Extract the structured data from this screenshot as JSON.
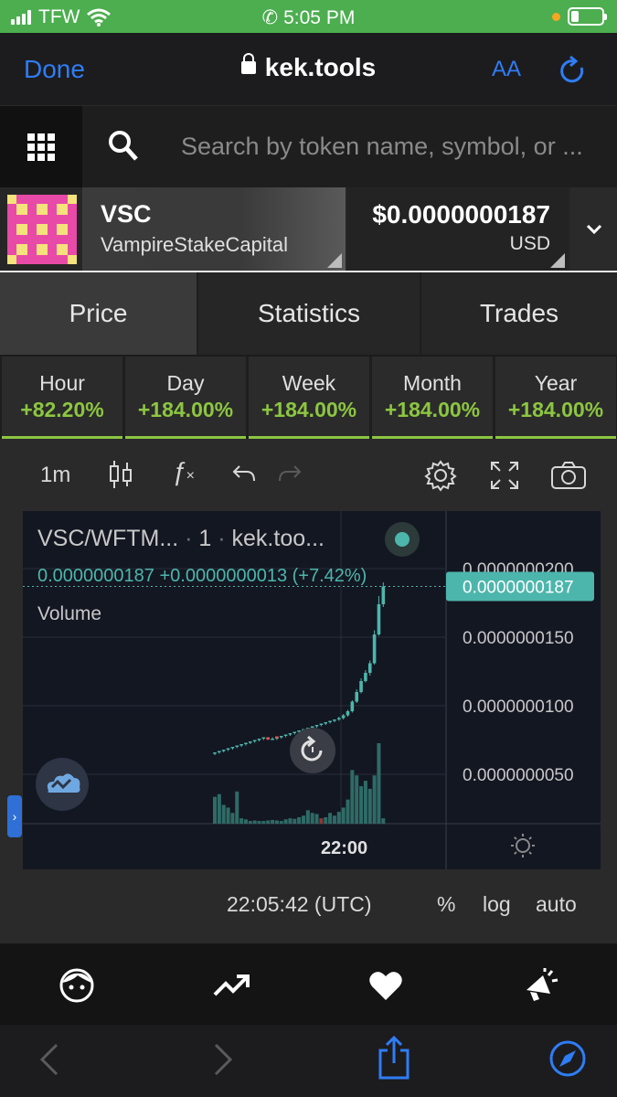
{
  "status_bar": {
    "carrier": "TFW",
    "time": "5:05 PM"
  },
  "browser": {
    "done_label": "Done",
    "url": "kek.tools",
    "text_size_label": "AA"
  },
  "search": {
    "placeholder": "Search by token name, symbol, or ..."
  },
  "token": {
    "symbol": "VSC",
    "name": "VampireStakeCapital",
    "price": "$0.0000000187",
    "currency": "USD"
  },
  "tabs": [
    {
      "label": "Price",
      "active": true
    },
    {
      "label": "Statistics",
      "active": false
    },
    {
      "label": "Trades",
      "active": false
    }
  ],
  "periods": [
    {
      "label": "Hour",
      "change": "+82.20%"
    },
    {
      "label": "Day",
      "change": "+184.00%"
    },
    {
      "label": "Week",
      "change": "+184.00%"
    },
    {
      "label": "Month",
      "change": "+184.00%"
    },
    {
      "label": "Year",
      "change": "+184.00%"
    }
  ],
  "chart_toolbar": {
    "interval": "1m"
  },
  "chart": {
    "pair": "VSC/WFTM...",
    "interval_label": "1",
    "source": "kek.too...",
    "last_price": "0.0000000187",
    "change": "+0.0000000013 (+7.42%)",
    "volume_label": "Volume",
    "price_axis_labels": [
      "0.0000000200",
      "0.0000000150",
      "0.0000000100",
      "0.0000000050"
    ],
    "time_label": "22:00",
    "clock": "22:05:42 (UTC)",
    "scale_percent": "%",
    "scale_log": "log",
    "scale_auto": "auto",
    "colors": {
      "up": "#4db6ac",
      "down": "#ef5350",
      "accent": "#8cc641",
      "link": "#2f7df6"
    }
  },
  "chart_data": {
    "type": "candlestick",
    "title": "",
    "ylim": [
      0.0,
      2.05e-08
    ],
    "y_ticks": [
      5e-09,
      1e-08,
      1.5e-08,
      2e-08
    ],
    "x_tick_labels": [
      "22:00"
    ],
    "candles": [
      {
        "o": 6.5e-09,
        "h": 6.6e-09,
        "l": 6.4e-09,
        "c": 6.6e-09
      },
      {
        "o": 6.6e-09,
        "h": 6.7e-09,
        "l": 6.5e-09,
        "c": 6.7e-09
      },
      {
        "o": 6.7e-09,
        "h": 6.8e-09,
        "l": 6.6e-09,
        "c": 6.8e-09
      },
      {
        "o": 6.8e-09,
        "h": 6.9e-09,
        "l": 6.7e-09,
        "c": 6.9e-09
      },
      {
        "o": 6.9e-09,
        "h": 7e-09,
        "l": 6.8e-09,
        "c": 7e-09
      },
      {
        "o": 7e-09,
        "h": 7.1e-09,
        "l": 6.9e-09,
        "c": 7.1e-09
      },
      {
        "o": 7.1e-09,
        "h": 7.2e-09,
        "l": 7e-09,
        "c": 7.2e-09
      },
      {
        "o": 7.2e-09,
        "h": 7.3e-09,
        "l": 7.1e-09,
        "c": 7.3e-09
      },
      {
        "o": 7.3e-09,
        "h": 7.4e-09,
        "l": 7.2e-09,
        "c": 7.4e-09
      },
      {
        "o": 7.4e-09,
        "h": 7.5e-09,
        "l": 7.3e-09,
        "c": 7.5e-09
      },
      {
        "o": 7.5e-09,
        "h": 7.6e-09,
        "l": 7.4e-09,
        "c": 7.6e-09
      },
      {
        "o": 7.6e-09,
        "h": 7.7e-09,
        "l": 7.5e-09,
        "c": 7.7e-09
      },
      {
        "o": 7.7e-09,
        "h": 7.7e-09,
        "l": 7.5e-09,
        "c": 7.6e-09
      },
      {
        "o": 7.6e-09,
        "h": 7.7e-09,
        "l": 7.5e-09,
        "c": 7.6e-09
      },
      {
        "o": 7.6e-09,
        "h": 7.7e-09,
        "l": 7.5e-09,
        "c": 7.7e-09
      },
      {
        "o": 7.7e-09,
        "h": 7.8e-09,
        "l": 7.6e-09,
        "c": 7.8e-09
      },
      {
        "o": 7.8e-09,
        "h": 7.9e-09,
        "l": 7.7e-09,
        "c": 7.9e-09
      },
      {
        "o": 7.9e-09,
        "h": 8e-09,
        "l": 7.8e-09,
        "c": 8e-09
      },
      {
        "o": 8e-09,
        "h": 8.1e-09,
        "l": 7.9e-09,
        "c": 8.1e-09
      },
      {
        "o": 8.1e-09,
        "h": 8.2e-09,
        "l": 8e-09,
        "c": 8.2e-09
      },
      {
        "o": 8.2e-09,
        "h": 8.3e-09,
        "l": 8.1e-09,
        "c": 8.3e-09
      },
      {
        "o": 8.3e-09,
        "h": 8.4e-09,
        "l": 8.2e-09,
        "c": 8.4e-09
      },
      {
        "o": 8.4e-09,
        "h": 8.5e-09,
        "l": 8.3e-09,
        "c": 8.5e-09
      },
      {
        "o": 8.5e-09,
        "h": 8.6e-09,
        "l": 8.4e-09,
        "c": 8.6e-09
      },
      {
        "o": 8.6e-09,
        "h": 8.7e-09,
        "l": 8.5e-09,
        "c": 8.7e-09
      },
      {
        "o": 8.7e-09,
        "h": 8.8e-09,
        "l": 8.6e-09,
        "c": 8.8e-09
      },
      {
        "o": 8.8e-09,
        "h": 8.9e-09,
        "l": 8.7e-09,
        "c": 8.9e-09
      },
      {
        "o": 8.9e-09,
        "h": 9e-09,
        "l": 8.8e-09,
        "c": 9e-09
      },
      {
        "o": 9e-09,
        "h": 9.2e-09,
        "l": 8.9e-09,
        "c": 9.1e-09
      },
      {
        "o": 9.1e-09,
        "h": 9.4e-09,
        "l": 9e-09,
        "c": 9.3e-09
      },
      {
        "o": 9.3e-09,
        "h": 9.7e-09,
        "l": 9.2e-09,
        "c": 9.6e-09
      },
      {
        "o": 9.6e-09,
        "h": 1.04e-08,
        "l": 9.5e-09,
        "c": 1.03e-08
      },
      {
        "o": 1.03e-08,
        "h": 1.12e-08,
        "l": 1.02e-08,
        "c": 1.1e-08
      },
      {
        "o": 1.1e-08,
        "h": 1.2e-08,
        "l": 1.09e-08,
        "c": 1.18e-08
      },
      {
        "o": 1.18e-08,
        "h": 1.26e-08,
        "l": 1.17e-08,
        "c": 1.24e-08
      },
      {
        "o": 1.24e-08,
        "h": 1.33e-08,
        "l": 1.22e-08,
        "c": 1.31e-08
      },
      {
        "o": 1.31e-08,
        "h": 1.55e-08,
        "l": 1.3e-08,
        "c": 1.52e-08
      },
      {
        "o": 1.52e-08,
        "h": 1.8e-08,
        "l": 1.51e-08,
        "c": 1.74e-08
      },
      {
        "o": 1.74e-08,
        "h": 1.9e-08,
        "l": 1.72e-08,
        "c": 1.87e-08
      }
    ],
    "volumes": [
      0.5,
      0.55,
      0.35,
      0.3,
      0.2,
      0.6,
      0.1,
      0.08,
      0.05,
      0.06,
      0.05,
      0.05,
      0.06,
      0.07,
      0.06,
      0.05,
      0.08,
      0.1,
      0.09,
      0.12,
      0.15,
      0.25,
      0.2,
      0.18,
      0.1,
      0.12,
      0.2,
      0.15,
      0.22,
      0.3,
      0.45,
      1.0,
      0.9,
      0.7,
      0.8,
      0.65,
      0.9,
      1.5,
      0.1
    ],
    "volume_down_index": 24
  },
  "app_nav": [
    "face-icon",
    "trending-icon",
    "heart-icon",
    "marketing-icon"
  ]
}
